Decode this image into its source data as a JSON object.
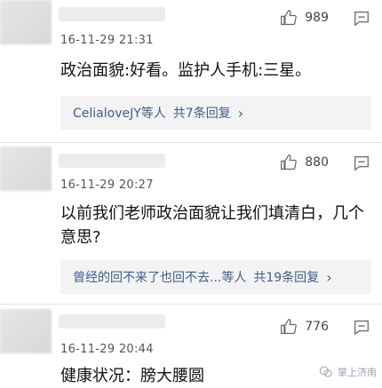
{
  "comments": [
    {
      "likes": "989",
      "time": "16-11-29 21:31",
      "text": "政治面貌:好看。监护人手机:三星。",
      "replies": {
        "users": "CelialoveJY等人",
        "count": "共7条回复"
      }
    },
    {
      "likes": "880",
      "time": "16-11-29 20:27",
      "text": "以前我们老师政治面貌让我们填清白，几个意思?",
      "replies": {
        "users": "曾经的回不来了也回不去...等人",
        "count": "共19条回复"
      }
    },
    {
      "likes": "776",
      "time": "16-11-29 20:44",
      "text": "健康状况：膀大腰圆"
    }
  ],
  "watermark": {
    "text": "掌上济南"
  },
  "icons": {
    "like": "thumbs-up-icon",
    "reply": "reply-icon",
    "chevron": "chevron-right-icon",
    "watermark": "wechat-icon"
  },
  "colors": {
    "link": "#3f5c8a",
    "reply_bg": "#f3f3f3"
  }
}
